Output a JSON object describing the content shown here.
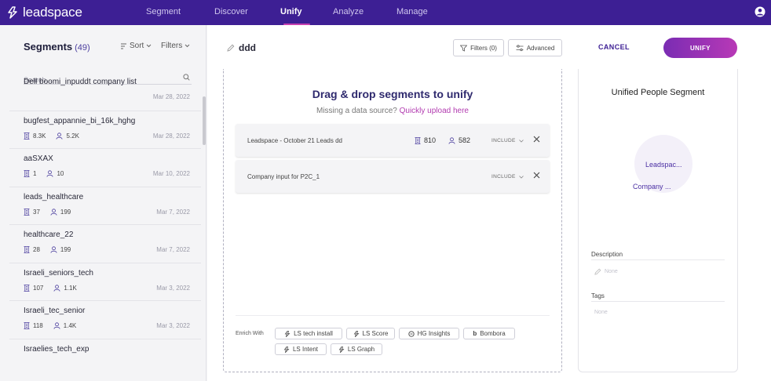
{
  "brand": {
    "name": "leadspace"
  },
  "nav": [
    {
      "label": "Segment",
      "active": false
    },
    {
      "label": "Discover",
      "active": false
    },
    {
      "label": "Unify",
      "active": true
    },
    {
      "label": "Analyze",
      "active": false
    },
    {
      "label": "Manage",
      "active": false
    }
  ],
  "left": {
    "title": "Segments",
    "count": "(49)",
    "sort_label": "Sort",
    "filters_label": "Filters",
    "search_placeholder": "Search...",
    "items": [
      {
        "name": "Dell boomi_inpuddt company list",
        "companies": "",
        "people": "",
        "date": "Mar 28, 2022"
      },
      {
        "name": "bugfest_appannie_bi_16k_hghg",
        "companies": "8.3K",
        "people": "5.2K",
        "date": "Mar 28, 2022"
      },
      {
        "name": "aaSXAX",
        "companies": "1",
        "people": "10",
        "date": "Mar 10, 2022"
      },
      {
        "name": "leads_healthcare",
        "companies": "37",
        "people": "199",
        "date": "Mar 7, 2022"
      },
      {
        "name": "healthcare_22",
        "companies": "28",
        "people": "199",
        "date": "Mar 7, 2022"
      },
      {
        "name": "Israeli_seniors_tech",
        "companies": "107",
        "people": "1.1K",
        "date": "Mar 3, 2022"
      },
      {
        "name": "Israeli_tec_senior",
        "companies": "118",
        "people": "1.4K",
        "date": "Mar 3, 2022"
      },
      {
        "name": "Israelies_tech_exp",
        "companies": "",
        "people": "",
        "date": ""
      }
    ]
  },
  "header": {
    "segment_name": "ddd",
    "filters_btn": "Filters (0)",
    "advanced_btn": "Advanced",
    "cancel_btn": "CANCEL",
    "unify_btn": "UNIFY"
  },
  "dropzone": {
    "title": "Drag & drop segments to unify",
    "subtitle": "Missing a data source?",
    "upload_link": "Quickly upload here",
    "sources": [
      {
        "name": "Leadspace - October 21 Leads dd",
        "companies": "810",
        "people": "582",
        "mode": "INCLUDE"
      },
      {
        "name": "Company input for P2C_1",
        "companies": "",
        "people": "",
        "mode": "INCLUDE"
      }
    ],
    "enrich_label": "Enrich With",
    "enrich": [
      {
        "label": "LS tech install",
        "icon": "leadspace-icon"
      },
      {
        "label": "LS Score",
        "icon": "leadspace-icon"
      },
      {
        "label": "HG Insights",
        "icon": "hg-icon"
      },
      {
        "label": "Bombora",
        "icon": "bombora-icon"
      },
      {
        "label": "LS Intent",
        "icon": "leadspace-icon"
      },
      {
        "label": "LS Graph",
        "icon": "leadspace-icon"
      }
    ]
  },
  "right": {
    "title": "Unified People Segment",
    "venn_labels": [
      "Leadspac...",
      "Company ..."
    ],
    "description_label": "Description",
    "description_value": "None",
    "tags_label": "Tags",
    "tags_value": "None"
  },
  "colors": {
    "nav_bg": "#3d1f94",
    "accent": "#b839b6",
    "link": "#b23bb0"
  }
}
